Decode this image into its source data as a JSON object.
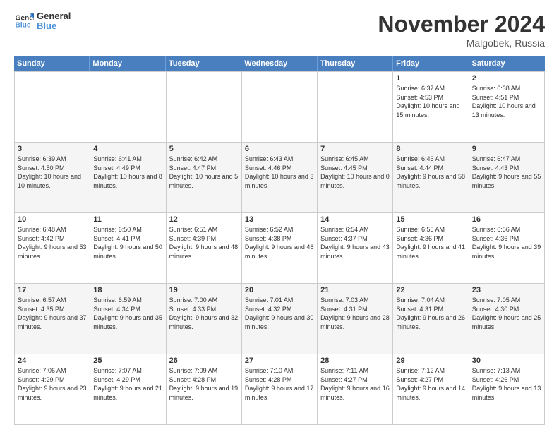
{
  "logo": {
    "line1": "General",
    "line2": "Blue"
  },
  "title": "November 2024",
  "location": "Malgobek, Russia",
  "header": {
    "days": [
      "Sunday",
      "Monday",
      "Tuesday",
      "Wednesday",
      "Thursday",
      "Friday",
      "Saturday"
    ]
  },
  "rows": [
    {
      "alt": false,
      "cells": [
        {
          "empty": true
        },
        {
          "empty": true
        },
        {
          "empty": true
        },
        {
          "empty": true
        },
        {
          "empty": true
        },
        {
          "day": 1,
          "sunrise": "6:37 AM",
          "sunset": "4:53 PM",
          "daylight": "10 hours and 15 minutes."
        },
        {
          "day": 2,
          "sunrise": "6:38 AM",
          "sunset": "4:51 PM",
          "daylight": "10 hours and 13 minutes."
        }
      ]
    },
    {
      "alt": true,
      "cells": [
        {
          "day": 3,
          "sunrise": "6:39 AM",
          "sunset": "4:50 PM",
          "daylight": "10 hours and 10 minutes."
        },
        {
          "day": 4,
          "sunrise": "6:41 AM",
          "sunset": "4:49 PM",
          "daylight": "10 hours and 8 minutes."
        },
        {
          "day": 5,
          "sunrise": "6:42 AM",
          "sunset": "4:47 PM",
          "daylight": "10 hours and 5 minutes."
        },
        {
          "day": 6,
          "sunrise": "6:43 AM",
          "sunset": "4:46 PM",
          "daylight": "10 hours and 3 minutes."
        },
        {
          "day": 7,
          "sunrise": "6:45 AM",
          "sunset": "4:45 PM",
          "daylight": "10 hours and 0 minutes."
        },
        {
          "day": 8,
          "sunrise": "6:46 AM",
          "sunset": "4:44 PM",
          "daylight": "9 hours and 58 minutes."
        },
        {
          "day": 9,
          "sunrise": "6:47 AM",
          "sunset": "4:43 PM",
          "daylight": "9 hours and 55 minutes."
        }
      ]
    },
    {
      "alt": false,
      "cells": [
        {
          "day": 10,
          "sunrise": "6:48 AM",
          "sunset": "4:42 PM",
          "daylight": "9 hours and 53 minutes."
        },
        {
          "day": 11,
          "sunrise": "6:50 AM",
          "sunset": "4:41 PM",
          "daylight": "9 hours and 50 minutes."
        },
        {
          "day": 12,
          "sunrise": "6:51 AM",
          "sunset": "4:39 PM",
          "daylight": "9 hours and 48 minutes."
        },
        {
          "day": 13,
          "sunrise": "6:52 AM",
          "sunset": "4:38 PM",
          "daylight": "9 hours and 46 minutes."
        },
        {
          "day": 14,
          "sunrise": "6:54 AM",
          "sunset": "4:37 PM",
          "daylight": "9 hours and 43 minutes."
        },
        {
          "day": 15,
          "sunrise": "6:55 AM",
          "sunset": "4:36 PM",
          "daylight": "9 hours and 41 minutes."
        },
        {
          "day": 16,
          "sunrise": "6:56 AM",
          "sunset": "4:36 PM",
          "daylight": "9 hours and 39 minutes."
        }
      ]
    },
    {
      "alt": true,
      "cells": [
        {
          "day": 17,
          "sunrise": "6:57 AM",
          "sunset": "4:35 PM",
          "daylight": "9 hours and 37 minutes."
        },
        {
          "day": 18,
          "sunrise": "6:59 AM",
          "sunset": "4:34 PM",
          "daylight": "9 hours and 35 minutes."
        },
        {
          "day": 19,
          "sunrise": "7:00 AM",
          "sunset": "4:33 PM",
          "daylight": "9 hours and 32 minutes."
        },
        {
          "day": 20,
          "sunrise": "7:01 AM",
          "sunset": "4:32 PM",
          "daylight": "9 hours and 30 minutes."
        },
        {
          "day": 21,
          "sunrise": "7:03 AM",
          "sunset": "4:31 PM",
          "daylight": "9 hours and 28 minutes."
        },
        {
          "day": 22,
          "sunrise": "7:04 AM",
          "sunset": "4:31 PM",
          "daylight": "9 hours and 26 minutes."
        },
        {
          "day": 23,
          "sunrise": "7:05 AM",
          "sunset": "4:30 PM",
          "daylight": "9 hours and 25 minutes."
        }
      ]
    },
    {
      "alt": false,
      "cells": [
        {
          "day": 24,
          "sunrise": "7:06 AM",
          "sunset": "4:29 PM",
          "daylight": "9 hours and 23 minutes."
        },
        {
          "day": 25,
          "sunrise": "7:07 AM",
          "sunset": "4:29 PM",
          "daylight": "9 hours and 21 minutes."
        },
        {
          "day": 26,
          "sunrise": "7:09 AM",
          "sunset": "4:28 PM",
          "daylight": "9 hours and 19 minutes."
        },
        {
          "day": 27,
          "sunrise": "7:10 AM",
          "sunset": "4:28 PM",
          "daylight": "9 hours and 17 minutes."
        },
        {
          "day": 28,
          "sunrise": "7:11 AM",
          "sunset": "4:27 PM",
          "daylight": "9 hours and 16 minutes."
        },
        {
          "day": 29,
          "sunrise": "7:12 AM",
          "sunset": "4:27 PM",
          "daylight": "9 hours and 14 minutes."
        },
        {
          "day": 30,
          "sunrise": "7:13 AM",
          "sunset": "4:26 PM",
          "daylight": "9 hours and 13 minutes."
        }
      ]
    }
  ]
}
